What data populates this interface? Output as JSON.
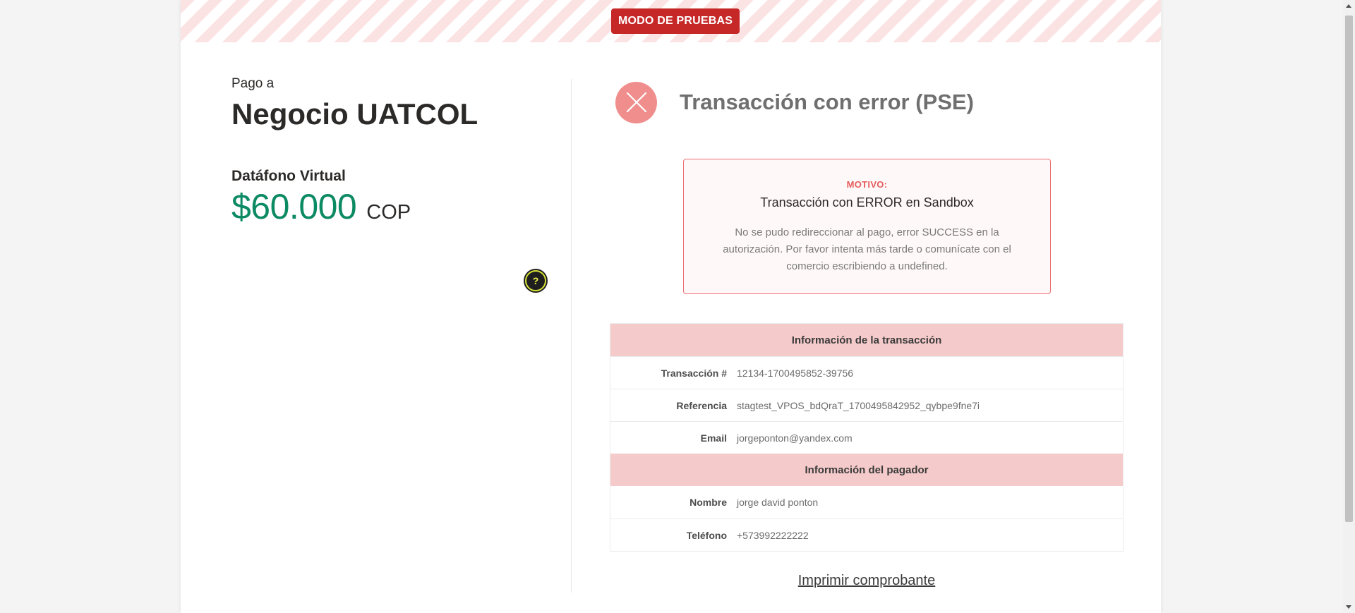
{
  "sandbox": {
    "badge": "MODO DE PRUEBAS"
  },
  "merchant": {
    "pay_to_label": "Pago a",
    "name": "Negocio UATCOL",
    "product": "Datáfono Virtual",
    "amount": "$60.000",
    "currency": "COP",
    "help_label": "?"
  },
  "status": {
    "title": "Transacción con error (PSE)",
    "icon": "close-icon",
    "reason_label": "MOTIVO:",
    "reason_title": "Transacción con ERROR en Sandbox",
    "reason_text": "No se pudo redireccionar al pago, error SUCCESS en la autorización. Por favor intenta más tarde o comunícate con el comercio escribiendo a undefined."
  },
  "transaction_info": {
    "header": "Información de la transacción",
    "rows": [
      {
        "label": "Transacción #",
        "value": "12134-1700495852-39756"
      },
      {
        "label": "Referencia",
        "value": "stagtest_VPOS_bdQraT_1700495842952_qybpe9fne7i"
      },
      {
        "label": "Email",
        "value": "jorgeponton@yandex.com"
      }
    ]
  },
  "payer_info": {
    "header": "Información del pagador",
    "rows": [
      {
        "label": "Nombre",
        "value": "jorge david ponton"
      },
      {
        "label": "Teléfono",
        "value": "+573992222222"
      }
    ]
  },
  "actions": {
    "print": "Imprimir comprobante"
  },
  "colors": {
    "sandbox_red": "#c62828",
    "amount_green": "#0c8a64",
    "error_icon": "#ef8e8c",
    "section_header": "#f5caca"
  }
}
